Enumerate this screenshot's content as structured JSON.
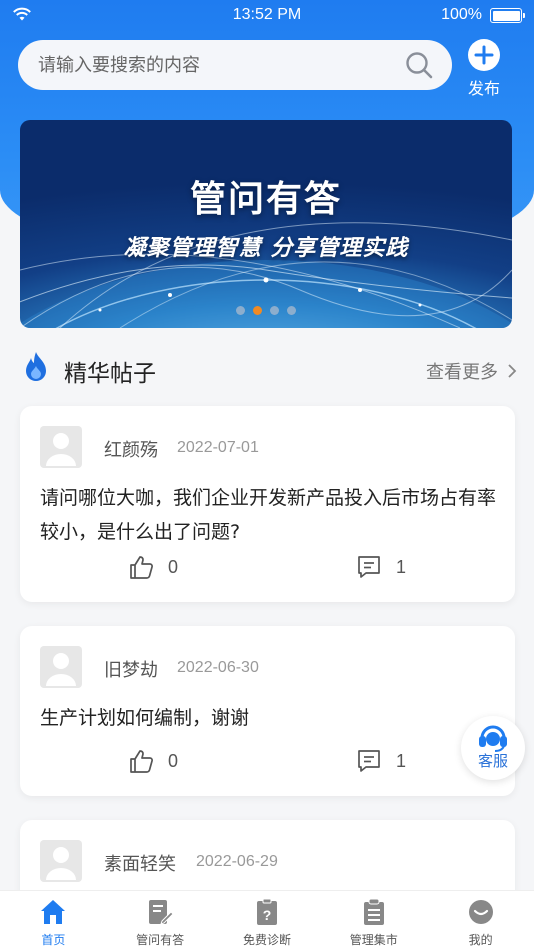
{
  "status_bar": {
    "time": "13:52 PM",
    "battery": "100%"
  },
  "search": {
    "placeholder": "请输入要搜索的内容"
  },
  "publish": {
    "label": "发布"
  },
  "banner": {
    "title": "管问有答",
    "subtitle": "凝聚管理智慧 分享管理实践",
    "slide_count": 4,
    "active_slide": 2
  },
  "section": {
    "title": "精华帖子",
    "more_label": "查看更多"
  },
  "posts": [
    {
      "username": "红颜殇",
      "date": "2022-07-01",
      "content": "请问哪位大咖，我们企业开发新产品投入后市场占有率较小，是什么出了问题?",
      "likes": "0",
      "comments": "1"
    },
    {
      "username": "旧梦劫",
      "date": "2022-06-30",
      "content": "生产计划如何编制，谢谢",
      "likes": "0",
      "comments": "1"
    },
    {
      "username": "素面轻笑",
      "date": "2022-06-29"
    }
  ],
  "service": {
    "label": "客服"
  },
  "tabbar": [
    {
      "label": "首页",
      "icon": "home-icon",
      "active": true
    },
    {
      "label": "管问有答",
      "icon": "qa-icon",
      "active": false
    },
    {
      "label": "免费诊断",
      "icon": "diagnosis-icon",
      "active": false
    },
    {
      "label": "管理集市",
      "icon": "market-icon",
      "active": false
    },
    {
      "label": "我的",
      "icon": "profile-icon",
      "active": false
    }
  ],
  "colors": {
    "primary": "#1f7cf0",
    "accent": "#f08a24"
  }
}
